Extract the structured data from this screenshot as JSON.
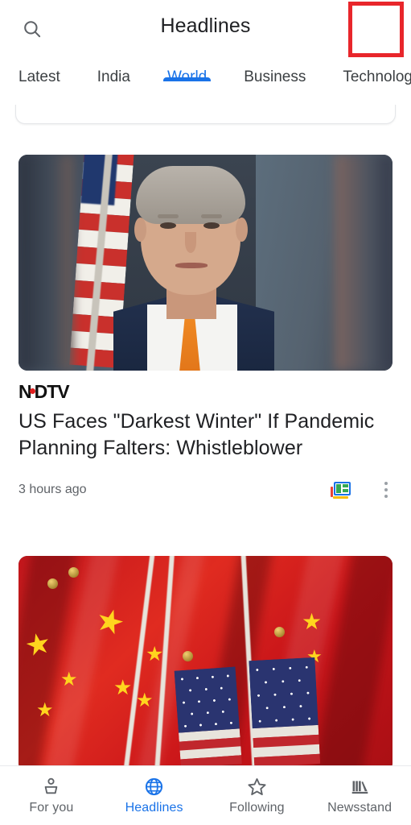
{
  "appbar": {
    "title": "Headlines",
    "search_icon": "search-icon",
    "avatar_icon": "account-avatar",
    "highlight_color": "#e8262b"
  },
  "tabs": {
    "accent_color": "#1a73e8",
    "items": [
      {
        "label": "Latest",
        "active": false
      },
      {
        "label": "India",
        "active": false
      },
      {
        "label": "World",
        "active": true
      },
      {
        "label": "Business",
        "active": false
      },
      {
        "label": "Technology",
        "active": false
      }
    ]
  },
  "feed": {
    "articles": [
      {
        "image_alt": "portrait-man-navy-suit-orange-tie-us-flag",
        "source": "NDTV",
        "headline": "US Faces \"Darkest Winter\" If Pandemic Planning Falters: Whistleblower",
        "timestamp": "3 hours ago",
        "full_coverage_icon": "full-coverage-icon",
        "overflow_icon": "more-options-icon"
      },
      {
        "image_alt": "china-and-usa-flags"
      }
    ]
  },
  "bottomnav": {
    "active_color": "#1a73e8",
    "items": [
      {
        "label": "For you",
        "icon": "person-icon",
        "active": false
      },
      {
        "label": "Headlines",
        "icon": "globe-icon",
        "active": true
      },
      {
        "label": "Following",
        "icon": "star-icon",
        "active": false
      },
      {
        "label": "Newsstand",
        "icon": "newsstand-icon",
        "active": false
      }
    ]
  }
}
